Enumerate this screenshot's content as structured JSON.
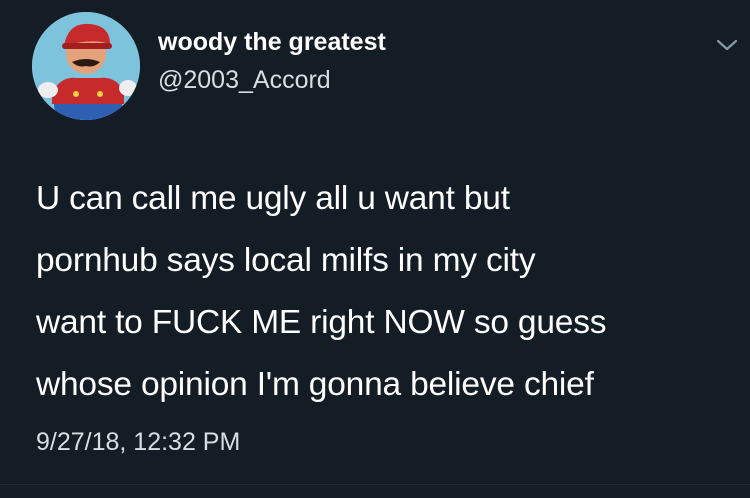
{
  "tweet": {
    "author": {
      "display_name": "woody the greatest",
      "handle": "@2003_Accord",
      "avatar_icon": "mario-avatar-icon"
    },
    "menu_icon": "chevron-down-icon",
    "text_lines": [
      "U can call me ugly all u want but",
      "pornhub says local milfs in my city",
      "want to FUCK ME right NOW so guess",
      "whose opinion I'm gonna believe chief"
    ],
    "timestamp": "9/27/18, 12:32 PM"
  },
  "colors": {
    "background": "#141d26",
    "text_primary": "#ffffff",
    "text_secondary": "#d7dde3",
    "avatar_bg": "#7ec3dc"
  }
}
